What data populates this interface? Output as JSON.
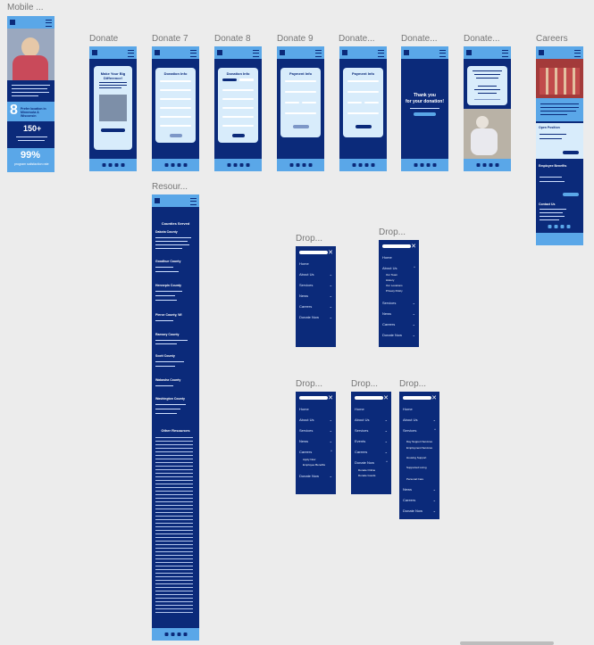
{
  "canvas": {
    "background": "#ececec",
    "accent": "#5aa7e8",
    "brand": "#0b2a7a"
  },
  "frames": [
    {
      "id": "mobile",
      "label": "Mobile ..."
    },
    {
      "id": "donate",
      "label": "Donate"
    },
    {
      "id": "donate7",
      "label": "Donate 7"
    },
    {
      "id": "donate8",
      "label": "Donate 8"
    },
    {
      "id": "donate9",
      "label": "Donate 9"
    },
    {
      "id": "donate10",
      "label": "Donate..."
    },
    {
      "id": "donate11",
      "label": "Donate..."
    },
    {
      "id": "donate12",
      "label": "Donate..."
    },
    {
      "id": "careers",
      "label": "Careers"
    },
    {
      "id": "resources",
      "label": "Resour..."
    },
    {
      "id": "drop1",
      "label": "Drop..."
    },
    {
      "id": "drop2",
      "label": "Drop..."
    },
    {
      "id": "drop3",
      "label": "Drop..."
    },
    {
      "id": "drop4",
      "label": "Drop..."
    },
    {
      "id": "drop5",
      "label": "Drop..."
    }
  ],
  "mobile": {
    "stat1": "8",
    "stat1_text": "Prefer location in Minnesota & Wisconsin",
    "stat2": "150+",
    "stat3": "99%",
    "stat3_text": "program satisfaction rate"
  },
  "donate": {
    "title": "Make Your Big Difference!",
    "button": "Donate to Prefer Now"
  },
  "donate_form": {
    "title": "Donation Info",
    "button": "Next"
  },
  "payment_form": {
    "title": "Payment Info",
    "button": "Complete Donation"
  },
  "thankyou": {
    "line1": "Thank you",
    "line2": "for your donation!",
    "button": "Return Home"
  },
  "careers": {
    "section1": "Open Position",
    "section2": "Employee Benefits",
    "section3": "Contact Us",
    "button": "Learn More"
  },
  "resources": {
    "title": "Counties Served",
    "other": "Other Resources",
    "counties": [
      "Dakota County",
      "Goodhue County",
      "Hennepin County",
      "Pierce County, WI",
      "Ramsey County",
      "Scott County",
      "Wabasha County",
      "Washington County"
    ]
  },
  "dropdowns": {
    "drop1": {
      "items": [
        "Home",
        "About Us",
        "Services",
        "News",
        "Careers",
        "Donate Now"
      ]
    },
    "drop2": {
      "items": [
        "Home",
        "About Us",
        "Services",
        "News",
        "Careers",
        "Donate Now"
      ],
      "sub": [
        "Our Team",
        "History",
        "Our Locations",
        "Privacy Policy"
      ]
    },
    "drop3": {
      "items": [
        "Home",
        "About Us",
        "Services",
        "News",
        "Careers",
        "Donate Now"
      ],
      "sub": [
        "Apply Now",
        "Employee Benefits"
      ]
    },
    "drop4": {
      "items": [
        "Home",
        "About Us",
        "Services",
        "Events",
        "Careers",
        "Donate Now"
      ],
      "sub": [
        "Donate Online",
        "Donate Goods"
      ]
    },
    "drop5": {
      "items": [
        "Home",
        "About Us",
        "Services",
        "News",
        "Careers",
        "Donate Now"
      ],
      "sub": [
        "Day Support Services",
        "Employment Services",
        "Housing Support",
        "Supported Living",
        "Personal Care"
      ]
    }
  }
}
